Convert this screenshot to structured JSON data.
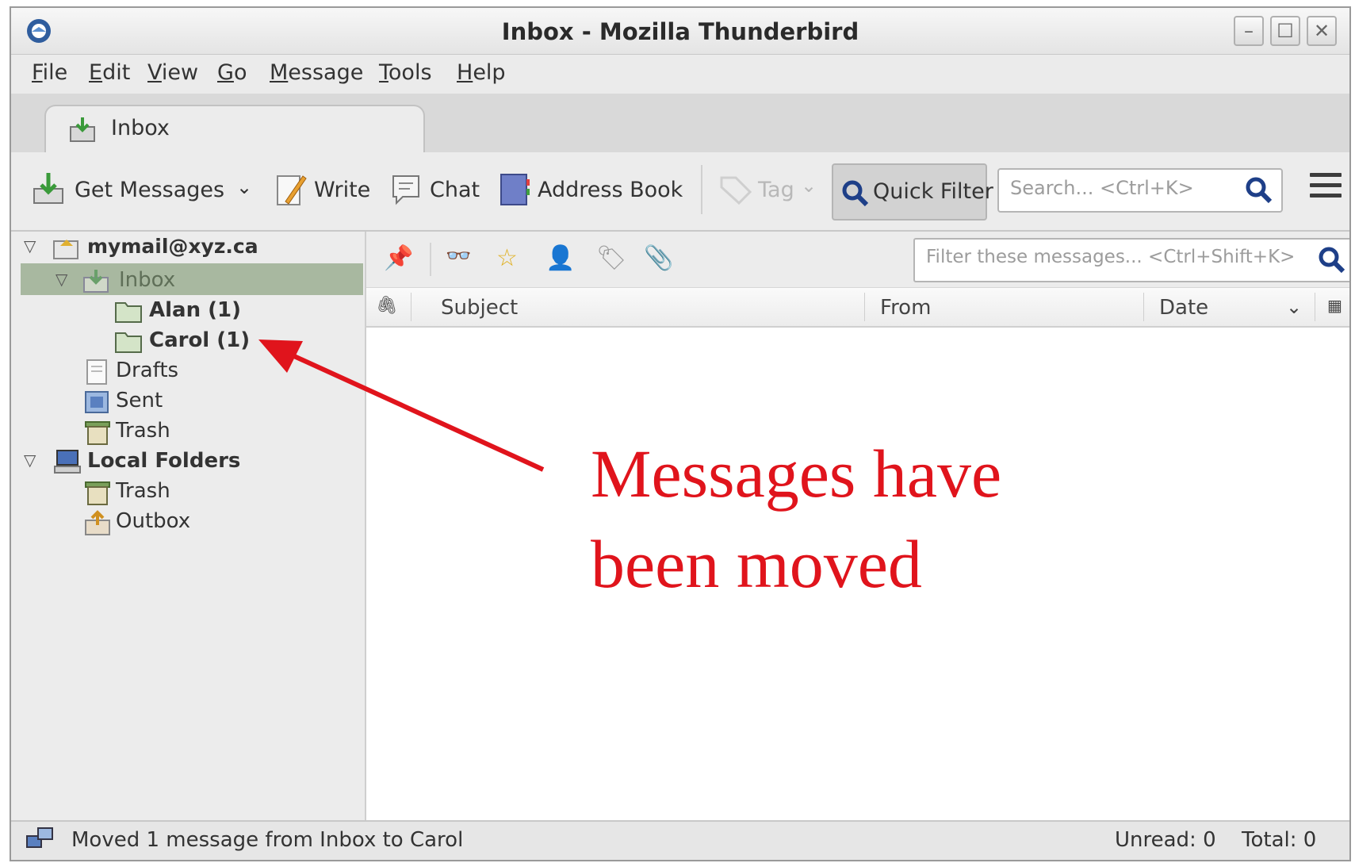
{
  "window": {
    "title": "Inbox - Mozilla Thunderbird"
  },
  "menu": {
    "items": [
      "File",
      "Edit",
      "View",
      "Go",
      "Message",
      "Tools",
      "Help"
    ]
  },
  "tab": {
    "label": "Inbox"
  },
  "toolbar": {
    "get_messages": "Get Messages",
    "write": "Write",
    "chat": "Chat",
    "address_book": "Address Book",
    "tag": "Tag",
    "quick_filter": "Quick Filter",
    "search_placeholder": "Search... <Ctrl+K>"
  },
  "folders": {
    "account": "mymail@xyz.ca",
    "inbox": "Inbox",
    "alan": "Alan (1)",
    "carol": "Carol (1)",
    "drafts": "Drafts",
    "sent": "Sent",
    "trash": "Trash",
    "local_folders": "Local Folders",
    "local_trash": "Trash",
    "outbox": "Outbox"
  },
  "quickfilter_bar": {
    "filter_placeholder": "Filter these messages... <Ctrl+Shift+K>"
  },
  "columns": {
    "subject": "Subject",
    "from": "From",
    "date": "Date"
  },
  "annotation": {
    "line1": "Messages have",
    "line2": "been moved",
    "color": "#e0141c"
  },
  "status": {
    "message": "Moved 1 message from Inbox to Carol",
    "unread": "Unread: 0",
    "total": "Total: 0"
  }
}
